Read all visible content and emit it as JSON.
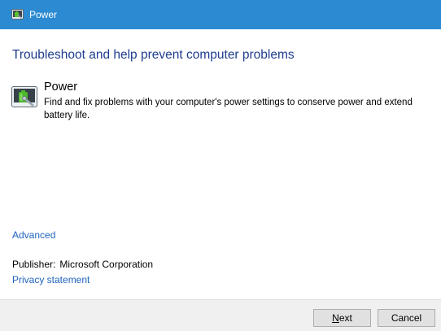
{
  "window": {
    "title": "Power"
  },
  "main": {
    "heading": "Troubleshoot and help prevent computer problems",
    "item": {
      "title": "Power",
      "description": "Find and fix problems with your computer's power settings to conserve power and extend battery life.",
      "icon": "battery-troubleshooter-icon"
    },
    "advanced_link": "Advanced",
    "publisher_label": "Publisher:",
    "publisher_value": "Microsoft Corporation",
    "privacy_link": "Privacy statement"
  },
  "footer": {
    "next_mnemonic": "N",
    "next_rest": "ext",
    "cancel_label": "Cancel"
  },
  "colors": {
    "titlebar": "#2b8ad2",
    "heading": "#1e3c8f",
    "link": "#1e64c0",
    "footer": "#f0f0f0"
  }
}
